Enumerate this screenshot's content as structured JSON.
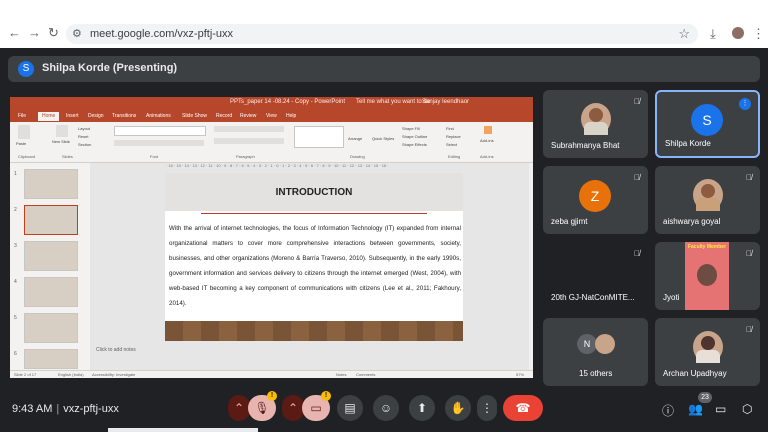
{
  "browser": {
    "url": "meet.google.com/vxz-pftj-uxx",
    "icons": [
      "back-icon",
      "forward-icon",
      "reload-icon",
      "tune-icon",
      "star-icon",
      "download-icon",
      "menu-icon"
    ]
  },
  "presenting": {
    "avatar_letter": "S",
    "label": "Shilpa Korde (Presenting)"
  },
  "powerpoint": {
    "title": "PPTs_paper 14 -08.24 - Copy - PowerPoint",
    "search": "Tell me what you want to do",
    "user": "Sanjay Ieendhaor",
    "tabs": [
      "File",
      "Home",
      "Insert",
      "Design",
      "Transitions",
      "Animations",
      "Slide Show",
      "Record",
      "Review",
      "View",
      "Help"
    ],
    "ribbon_groups": [
      "Clipboard",
      "Slides",
      "Font",
      "Paragraph",
      "Drawing",
      "Editing",
      "Add-ins"
    ],
    "ribbon_items": {
      "paste": "Paste",
      "new_slide": "New Slide",
      "layout": "Layout",
      "reset": "Reset",
      "section": "Section",
      "arrange": "Arrange",
      "quick_styles": "Quick Styles",
      "find": "Find",
      "replace": "Replace",
      "select": "Select",
      "addins": "Add-ins",
      "shape_fill": "Shape Fill",
      "shape_outline": "Shape Outline",
      "shape_effects": "Shape Effects"
    },
    "slide_numbers": [
      "1",
      "2",
      "3",
      "4",
      "5",
      "6"
    ],
    "selected_slide": 2,
    "slide": {
      "heading": "INTRODUCTION",
      "body": "With the arrival of internet technologies, the focus of Information Technology (IT) expanded from internal organizational matters to cover more comprehensive interactions between governments, society, businesses, and other organizations (Moreno & Barría Traverso, 2010). Subsequently, in the early 1990s, government information and services delivery to citizens through the internet emerged (West, 2004), with web-based IT becoming a key component of communications with citizens (Lee et al., 2011; Fakhoury, 2014)."
    },
    "notes_placeholder": "Click to add notes",
    "status": {
      "slide": "Slide 2 of 17",
      "language": "English (India)",
      "accessibility": "Accessibility: Investigate",
      "notes": "Notes",
      "comments": "Comments",
      "zoom": "57%"
    }
  },
  "participants": [
    {
      "name": "Subrahmanya Bhat",
      "type": "photo",
      "muted": true
    },
    {
      "name": "Shilpa Korde",
      "type": "letter",
      "letter": "S",
      "color": "#1a73e8",
      "speaking": true
    },
    {
      "name": "zeba gjimt",
      "type": "letter",
      "letter": "Z",
      "color": "#e8710a",
      "muted": true
    },
    {
      "name": "aishwarya goyal",
      "type": "photo",
      "muted": true
    },
    {
      "name": "20th GJ-NatConMITE...",
      "type": "blank",
      "muted": true
    },
    {
      "name": "Jyoti",
      "type": "poster",
      "poster_label": "Faculty Member",
      "muted": true
    },
    {
      "name": "15 others",
      "type": "group",
      "letter": "N"
    },
    {
      "name": "Archan Upadhyay",
      "type": "photo",
      "muted": true
    }
  ],
  "bottom_bar": {
    "time": "9:43 AM",
    "meeting_code": "vxz-pftj-uxx",
    "warning_mark": "!",
    "participant_count": "23",
    "controls": [
      "mic-off-icon",
      "camera-off-icon",
      "captions-icon",
      "emoji-icon",
      "present-icon",
      "raise-hand-icon",
      "more-options-icon",
      "leave-call-icon"
    ],
    "right_icons": [
      "info-icon",
      "people-icon",
      "chat-icon",
      "activities-icon",
      "host-controls-icon"
    ]
  }
}
